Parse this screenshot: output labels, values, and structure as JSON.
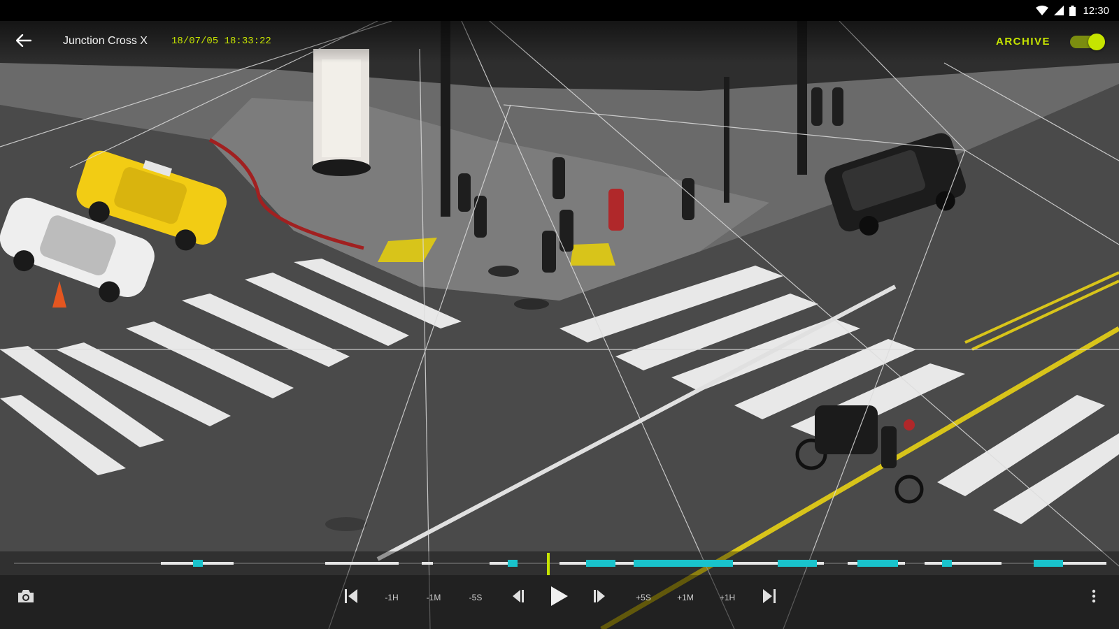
{
  "status_bar": {
    "time": "12:30"
  },
  "header": {
    "camera_name": "Junction Cross X",
    "timestamp": "18/07/05 18:33:22",
    "archive_label": "ARCHIVE",
    "archive_enabled": true
  },
  "timeline": {
    "playhead_fraction": 0.49
  },
  "controls": {
    "back_1h_label": "-1H",
    "back_1m_label": "-1M",
    "back_5s_label": "-5S",
    "fwd_5s_label": "+5S",
    "fwd_1m_label": "+1M",
    "fwd_1h_label": "+1H"
  },
  "icons": {
    "back": "arrow-left-icon",
    "wifi": "wifi-icon",
    "signal": "signal-icon",
    "battery": "battery-icon",
    "snapshot": "camera-icon",
    "skip_start": "skip-previous-icon",
    "step_back": "step-back-icon",
    "play": "play-icon",
    "step_forward": "step-forward-icon",
    "skip_end": "skip-next-icon",
    "more": "more-vertical-icon"
  },
  "colors": {
    "accent": "#c6e400",
    "event": "#19c3cc",
    "recording": "#e6e6e6"
  }
}
